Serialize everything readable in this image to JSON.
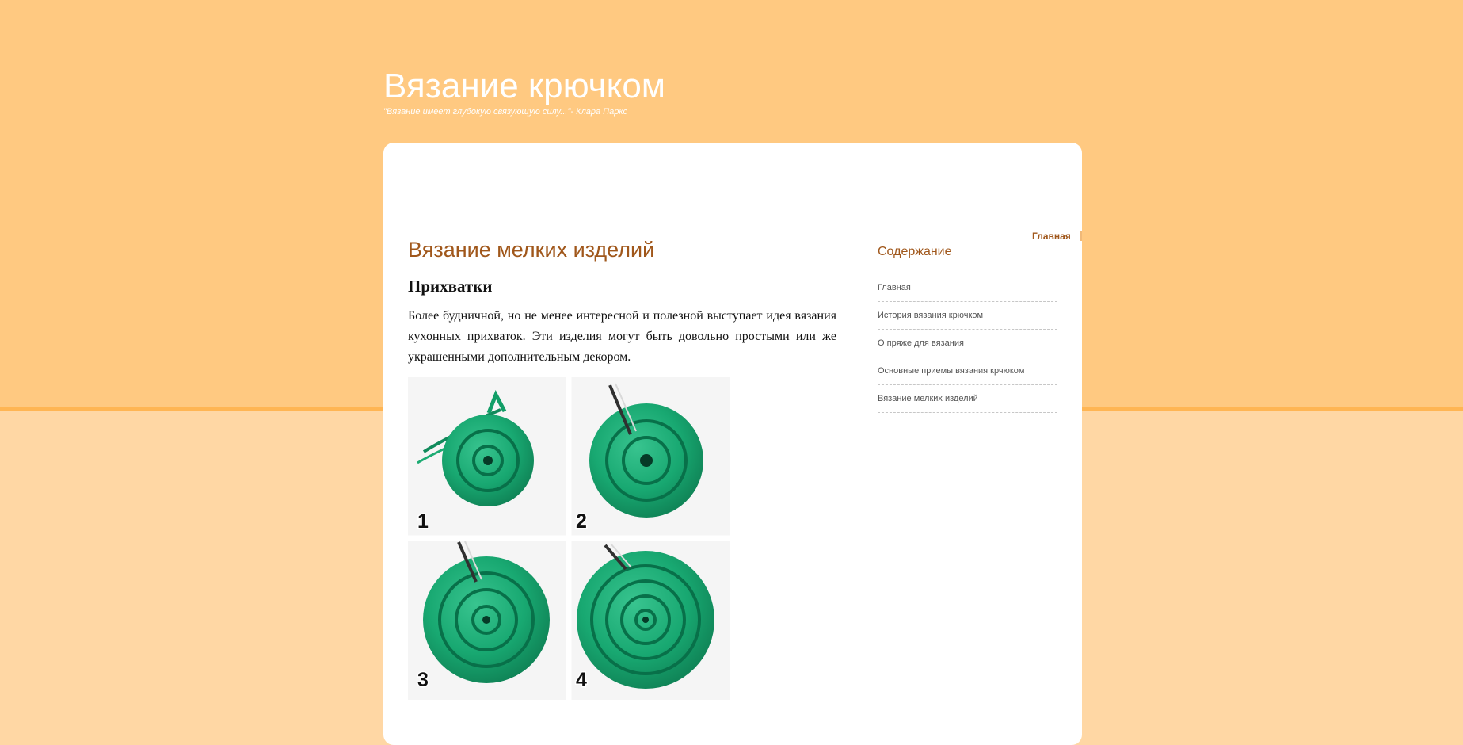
{
  "site": {
    "title": "Вязание крючком",
    "tagline": "\"Вязание имеет глубокую связующую силу...\"- Клара Паркс"
  },
  "nav": {
    "home": "Главная"
  },
  "article": {
    "title": "Вязание мелких изделий",
    "section_heading": "Прихватки",
    "paragraph": "Более будничной, но не менее интересной и полезной выступает идея вязания кухонных прихваток. Эти изделия могут быть довольно простыми или же украшенными дополнительным декором.",
    "photo_step_labels": [
      "1",
      "2",
      "3",
      "4"
    ]
  },
  "sidebar": {
    "title": "Содержание",
    "items": [
      {
        "label": "Главная"
      },
      {
        "label": "История вязания крючком"
      },
      {
        "label": "О пряже для вязания"
      },
      {
        "label": "Основные приемы вязания крчюком"
      },
      {
        "label": "Вязание мелких изделий"
      }
    ]
  },
  "colors": {
    "top_band": "#ffc981",
    "page_background": "#ffd7a4",
    "accent": "#a0571b",
    "yarn_green": "#18a871"
  }
}
